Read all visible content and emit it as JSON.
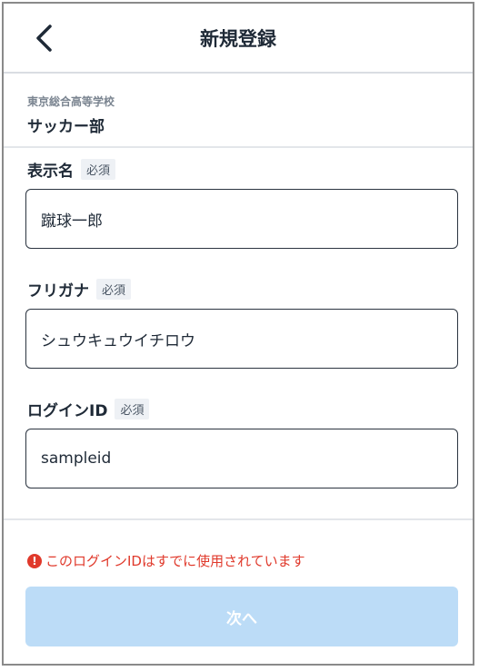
{
  "header": {
    "title": "新規登録",
    "back_icon": "chevron-left-icon"
  },
  "team": {
    "school": "東京総合高等学校",
    "club": "サッカー部"
  },
  "fields": [
    {
      "label": "表示名",
      "required": "必須",
      "value": "蹴球一郎"
    },
    {
      "label": "フリガナ",
      "required": "必須",
      "value": "シュウキュウイチロウ"
    },
    {
      "label": "ログインID",
      "required": "必須",
      "value": "sampleid"
    }
  ],
  "error": {
    "icon": "exclamation-circle-icon",
    "icon_glyph": "!",
    "message": "このログインIDはすでに使用されています"
  },
  "next_button": {
    "label": "次へ",
    "state": "disabled"
  },
  "colors": {
    "error": "#e0392b",
    "button_disabled": "#bcdcf7",
    "text": "#1f2a37"
  }
}
